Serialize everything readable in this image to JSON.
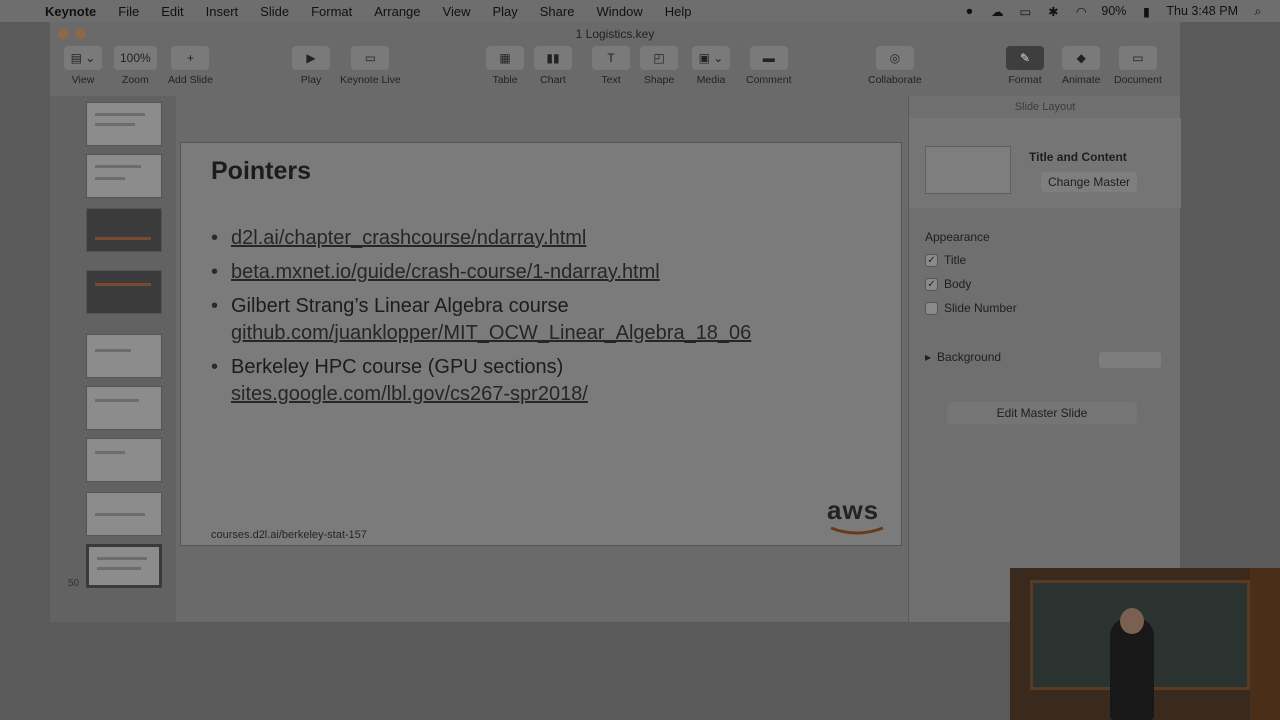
{
  "menubar": {
    "items": [
      "Keynote",
      "File",
      "Edit",
      "Insert",
      "Slide",
      "Format",
      "Arrange",
      "View",
      "Play",
      "Share",
      "Window",
      "Help"
    ],
    "battery": "90%",
    "clock": "Thu 3:48 PM"
  },
  "window": {
    "title": "1 Logistics.key"
  },
  "toolbar": {
    "zoom_value": "100%",
    "labels": [
      "View",
      "Zoom",
      "Add Slide",
      "Play",
      "Keynote Live",
      "Table",
      "Chart",
      "Text",
      "Shape",
      "Media",
      "Comment",
      "Collaborate",
      "Format",
      "Animate",
      "Document"
    ]
  },
  "navigator": {
    "active_slide_number": "50"
  },
  "slide": {
    "title": "Pointers",
    "bullets": [
      {
        "line1": "d2l.ai/chapter_crashcourse/ndarray.html",
        "line2": ""
      },
      {
        "line1": "beta.mxnet.io/guide/crash-course/1-ndarray.html",
        "line2": ""
      },
      {
        "line1": "Gilbert Strang’s Linear Algebra course",
        "line2": "github.com/juanklopper/MIT_OCW_Linear_Algebra_18_06"
      },
      {
        "line1": "Berkeley HPC course (GPU sections)",
        "line2": "sites.google.com/lbl.gov/cs267-spr2018/"
      }
    ],
    "footer": "courses.d2l.ai/berkeley-stat-157",
    "logo_text": "aws"
  },
  "inspector": {
    "header": "Slide Layout",
    "master_name": "Title and Content",
    "change_master": "Change Master",
    "appearance_title": "Appearance",
    "options": [
      {
        "label": "Title",
        "checked": true
      },
      {
        "label": "Body",
        "checked": true
      },
      {
        "label": "Slide Number",
        "checked": false
      }
    ],
    "background_label": "Background",
    "edit_master": "Edit Master Slide"
  }
}
